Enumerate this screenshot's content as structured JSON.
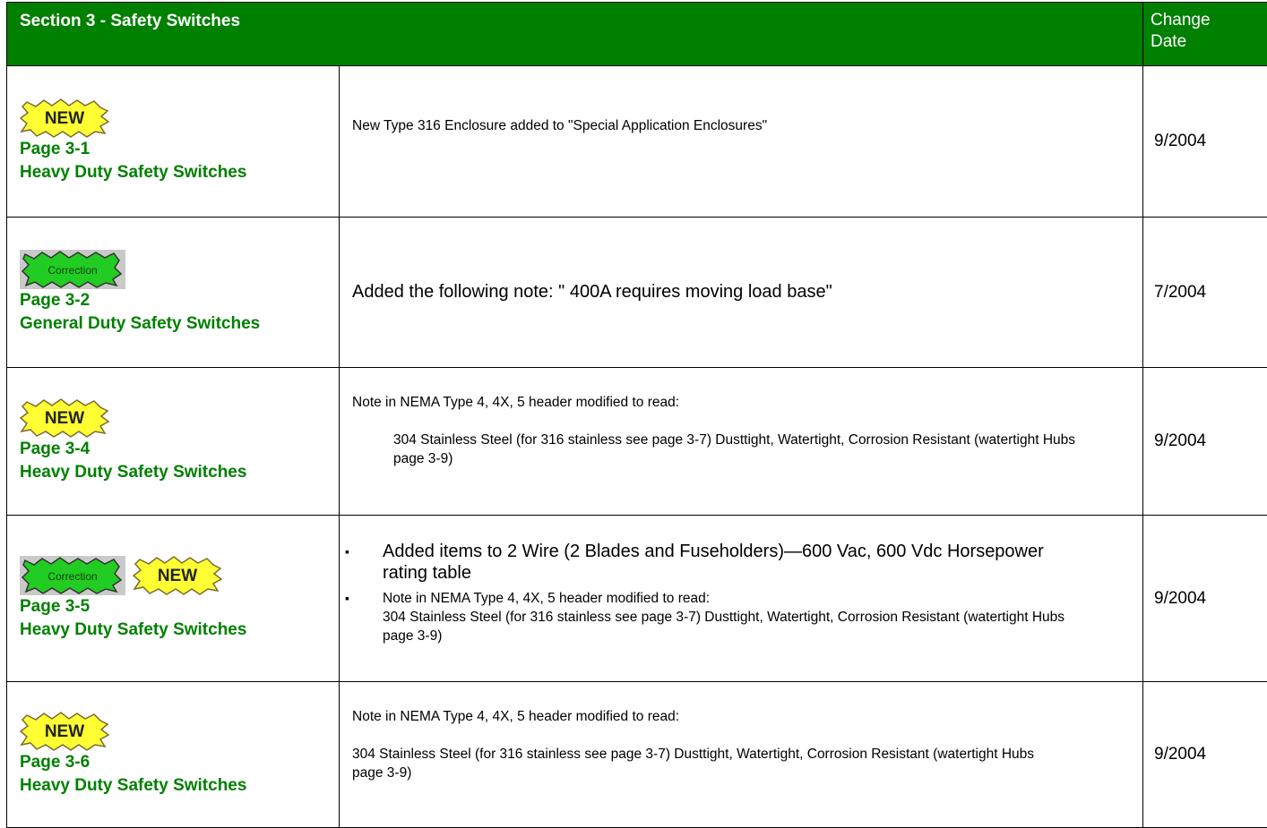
{
  "header": {
    "section_title": "Section 3 - Safety Switches",
    "date_label_line1": "Change",
    "date_label_line2": "Date"
  },
  "badges": {
    "new_text": "NEW",
    "correction_text": "Correction"
  },
  "rows": [
    {
      "page": "Page 3-1",
      "title": "Heavy Duty Safety Switches",
      "description": "New Type 316 Enclosure added to \"Special Application Enclosures\"",
      "date": "9/2004"
    },
    {
      "page": "Page 3-2",
      "title": "General Duty Safety Switches",
      "description": "Added the following note: \" 400A requires moving load base\"",
      "date": "7/2004"
    },
    {
      "page": "Page 3-4",
      "title": "Heavy Duty Safety Switches",
      "description_intro": "Note in NEMA Type 4, 4X, 5 header modified to read:",
      "description_detail": "304 Stainless Steel (for 316 stainless see page 3-7) Dusttight, Watertight, Corrosion Resistant (watertight Hubs page 3-9)",
      "date": "9/2004"
    },
    {
      "page": "Page 3-5",
      "title": "Heavy Duty Safety Switches",
      "bullet1": "Added items to 2 Wire (2 Blades and Fuseholders)—600 Vac, 600 Vdc Horsepower rating table",
      "bullet2_intro": "Note in NEMA Type 4, 4X, 5 header modified to read:",
      "bullet2_detail": "304 Stainless Steel (for 316 stainless see page 3-7) Dusttight, Watertight, Corrosion Resistant (watertight Hubs page 3-9)",
      "date": "9/2004"
    },
    {
      "page": "Page 3-6",
      "title": "Heavy Duty Safety Switches",
      "description_intro": "Note in NEMA Type 4, 4X, 5 header modified to read:",
      "description_detail": "304 Stainless Steel (for 316 stainless see page 3-7) Dusttight, Watertight, Corrosion Resistant (watertight Hubs page 3-9)",
      "date": "9/2004"
    }
  ],
  "colors": {
    "header_bg": "#008000",
    "link_green": "#008000",
    "badge_yellow": "#ffff33",
    "badge_green": "#22cc22"
  }
}
